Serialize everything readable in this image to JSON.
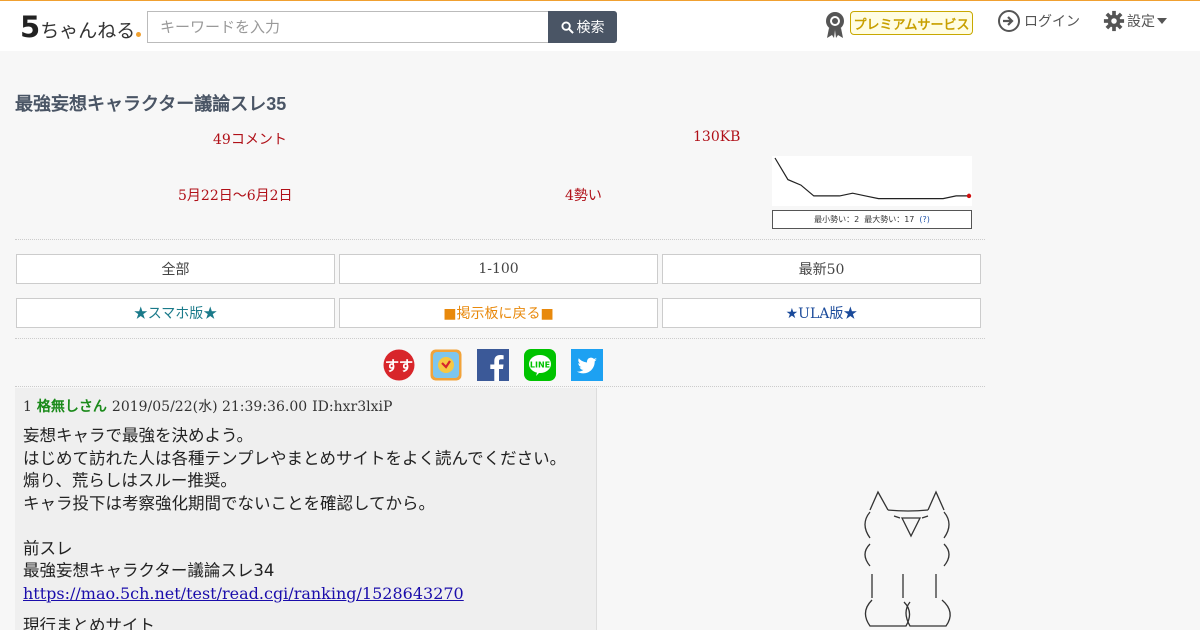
{
  "header": {
    "logo_text": "ちゃんねる",
    "logo_number": "5",
    "search_placeholder": "キーワードを入力",
    "search_button": "検索",
    "premium_label": "プレミアムサービス",
    "login_label": "ログイン",
    "settings_label": "設定"
  },
  "thread": {
    "title": "最強妄想キャラクター議論スレ35",
    "comments": "49コメント",
    "size": "130KB",
    "period": "5月22日〜6月2日",
    "momentum": "4勢い"
  },
  "momentum_graph": {
    "min_label": "最小勢い：2",
    "max_label": "最大勢い：17",
    "help_label": "(?)",
    "points": [
      17,
      9,
      7,
      3,
      3,
      3,
      4,
      3,
      2,
      2,
      2,
      2,
      2,
      2,
      3,
      3
    ],
    "line_color": "#222222",
    "end_marker_color": "#d01010"
  },
  "nav": {
    "row1": [
      "全部",
      "1-100",
      "最新50"
    ],
    "row2": [
      "★スマホ版★",
      "■掲示板に戻る■",
      "★ULA版★"
    ]
  },
  "share_icons": [
    "sumaho-icon",
    "bookmark-icon",
    "facebook-icon",
    "line-icon",
    "twitter-icon"
  ],
  "share_labels": {
    "line": "LINE",
    "sumaho": "すす"
  },
  "post": {
    "number": "1",
    "name": "格無しさん",
    "date": "2019/05/22(水) 21:39:36.00",
    "id": "ID:hxr3lxiP",
    "lines": [
      "妄想キャラで最強を決めよう。",
      "はじめて訪れた人は各種テンプレやまとめサイトをよく読んでください。",
      "煽り、荒らしはスルー推奨。",
      "キャラ投下は考察強化期間でないことを確認してから。",
      "",
      "前スレ",
      "最強妄想キャラクター議論スレ34"
    ],
    "link": "https://mao.5ch.net/test/read.cgi/ranking/1528643270",
    "cut_line": "現行まとめサイト"
  },
  "colors": {
    "accent": "#f0a030",
    "title": "#4a5565",
    "stat": "#b01018",
    "name": "#1a8a1a",
    "premium": "#c8a000"
  }
}
